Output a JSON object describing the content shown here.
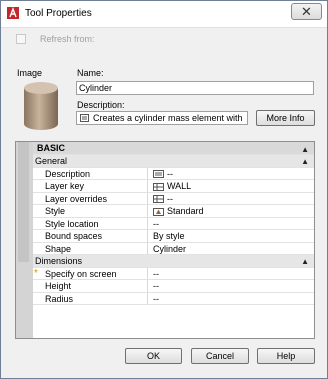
{
  "window": {
    "title": "Tool Properties",
    "close_symbol": "✕"
  },
  "refresh": {
    "label": "Refresh from:",
    "checked": false
  },
  "image_section": {
    "label": "Image"
  },
  "name": {
    "label": "Name:",
    "value": "Cylinder"
  },
  "description": {
    "label": "Description:",
    "value": "Creates a cylinder mass element with",
    "more_button": "More Info"
  },
  "properties": {
    "section": "BASIC",
    "general": {
      "label": "General",
      "rows": [
        {
          "key": "Description",
          "value": "--",
          "icon": "doc-icon"
        },
        {
          "key": "Layer key",
          "value": "WALL",
          "icon": "grid-icon"
        },
        {
          "key": "Layer overrides",
          "value": "--",
          "icon": "grid-icon"
        },
        {
          "key": "Style",
          "value": "Standard",
          "icon": "style-icon"
        },
        {
          "key": "Style location",
          "value": "--"
        },
        {
          "key": "Bound spaces",
          "value": "By style"
        },
        {
          "key": "Shape",
          "value": "Cylinder"
        }
      ]
    },
    "dimensions": {
      "label": "Dimensions",
      "rows": [
        {
          "key": "Specify on screen",
          "value": "--",
          "marker": "*"
        },
        {
          "key": "Height",
          "value": "--"
        },
        {
          "key": "Radius",
          "value": "--"
        }
      ]
    }
  },
  "buttons": {
    "ok": "OK",
    "cancel": "Cancel",
    "help": "Help"
  }
}
